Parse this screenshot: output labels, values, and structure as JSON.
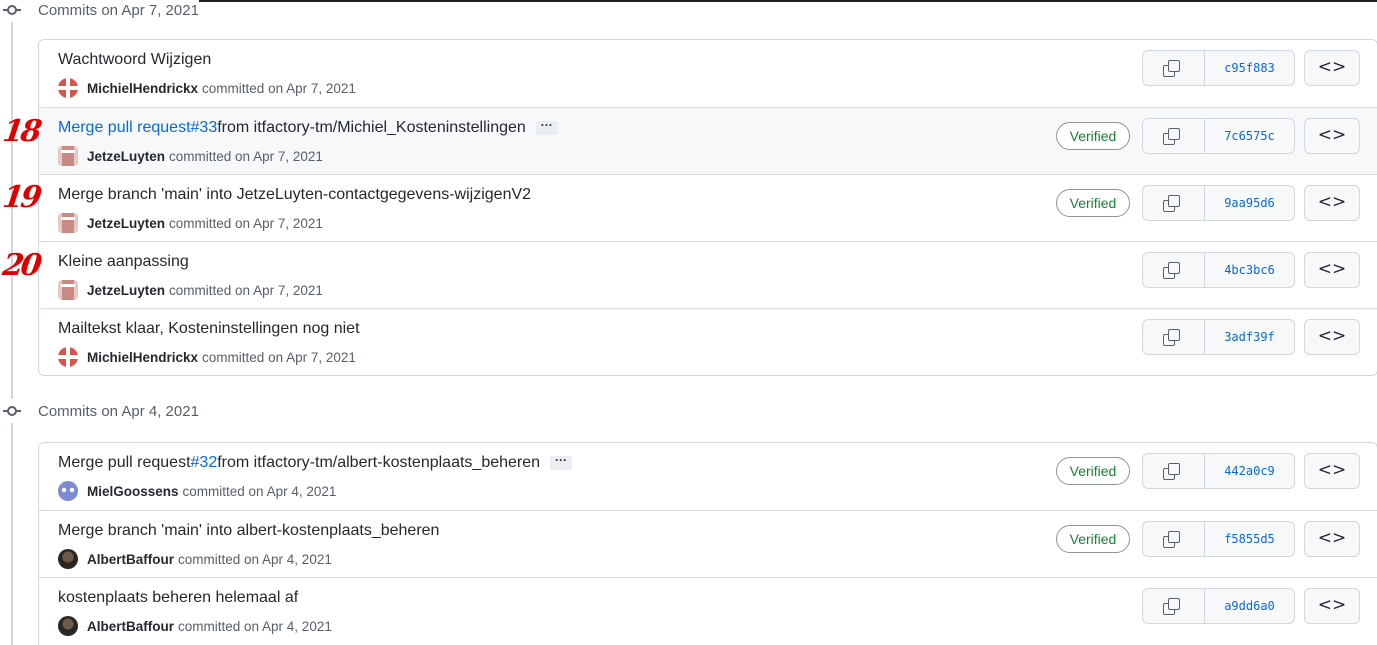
{
  "groups": [
    {
      "title": "Commits on Apr 7, 2021",
      "commits": [
        {
          "title": "Wachtwoord Wijzigen",
          "author": "MichielHendrickx",
          "committed": "committed on Apr 7, 2021",
          "sha": "c95f883"
        },
        {
          "title_link": "Merge pull request ",
          "pr": "#33",
          "title_rest": " from itfactory-tm/Michiel_Kosteninstellingen",
          "ellipsis": "···",
          "author": "JetzeLuyten",
          "committed": "committed on Apr 7, 2021",
          "sha": "7c6575c",
          "verified": "Verified"
        },
        {
          "title": "Merge branch 'main' into JetzeLuyten-contactgegevens-wijzigenV2",
          "author": "JetzeLuyten",
          "committed": "committed on Apr 7, 2021",
          "sha": "9aa95d6",
          "verified": "Verified"
        },
        {
          "title": "Kleine aanpassing",
          "author": "JetzeLuyten",
          "committed": "committed on Apr 7, 2021",
          "sha": "4bc3bc6"
        },
        {
          "title": "Mailtekst klaar, Kosteninstellingen nog niet",
          "author": "MichielHendrickx",
          "committed": "committed on Apr 7, 2021",
          "sha": "3adf39f"
        }
      ]
    },
    {
      "title": "Commits on Apr 4, 2021",
      "commits": [
        {
          "title_plain": "Merge pull request ",
          "pr": "#32",
          "title_rest": " from itfactory-tm/albert-kostenplaats_beheren",
          "ellipsis": "···",
          "author": "MielGoossens",
          "committed": "committed on Apr 4, 2021",
          "sha": "442a0c9",
          "verified": "Verified"
        },
        {
          "title": "Merge branch 'main' into albert-kostenplaats_beheren",
          "author": "AlbertBaffour",
          "committed": "committed on Apr 4, 2021",
          "sha": "f5855d5",
          "verified": "Verified"
        },
        {
          "title": "kostenplaats beheren helemaal af",
          "author": "AlbertBaffour",
          "committed": "committed on Apr 4, 2021",
          "sha": "a9dd6a0"
        }
      ]
    }
  ],
  "annotations": [
    "18",
    "19",
    "20"
  ],
  "browse_glyph": "<>",
  "colors": {
    "link": "#0969da",
    "verified": "#1a7f37",
    "annotation": "#e00000",
    "border": "#d0d7de"
  }
}
